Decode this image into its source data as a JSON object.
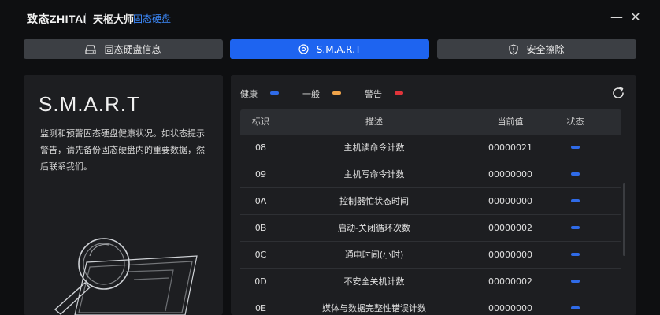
{
  "window": {
    "brand": "致态ZHITAI",
    "app_name": "天枢大师",
    "app_sub": "固态硬盘",
    "minimize_glyph": "—",
    "close_glyph": "✕"
  },
  "tabs": [
    {
      "label": "固态硬盘信息",
      "icon": "disk-icon",
      "active": false
    },
    {
      "label": "S.M.A.R.T",
      "icon": "smart-icon",
      "active": true
    },
    {
      "label": "安全擦除",
      "icon": "shield-icon",
      "active": false
    }
  ],
  "left": {
    "title": "S.M.A.R.T",
    "description": "监测和预警固态硬盘健康状况。如状态提示警告，请先备份固态硬盘内的重要数据，然后联系我们。"
  },
  "legend": [
    {
      "label": "健康",
      "color": "#2f6be8"
    },
    {
      "label": "一般",
      "color": "#f0a44a"
    },
    {
      "label": "警告",
      "color": "#e0343a"
    }
  ],
  "table": {
    "headers": {
      "id": "标识",
      "desc": "描述",
      "value": "当前值",
      "status": "状态"
    },
    "rows": [
      {
        "id": "08",
        "desc": "主机读命令计数",
        "value": "00000021",
        "status": "健康"
      },
      {
        "id": "09",
        "desc": "主机写命令计数",
        "value": "00000000",
        "status": "健康"
      },
      {
        "id": "0A",
        "desc": "控制器忙状态时间",
        "value": "00000000",
        "status": "健康"
      },
      {
        "id": "0B",
        "desc": "启动-关闭循环次数",
        "value": "00000002",
        "status": "健康"
      },
      {
        "id": "0C",
        "desc": "通电时间(小时)",
        "value": "00000000",
        "status": "健康"
      },
      {
        "id": "0D",
        "desc": "不安全关机计数",
        "value": "00000002",
        "status": "健康"
      },
      {
        "id": "0E",
        "desc": "媒体与数据完整性错误计数",
        "value": "00000000",
        "status": "健康"
      }
    ]
  },
  "colors": {
    "accent": "#1e64f0",
    "healthy": "#2f6be8"
  }
}
